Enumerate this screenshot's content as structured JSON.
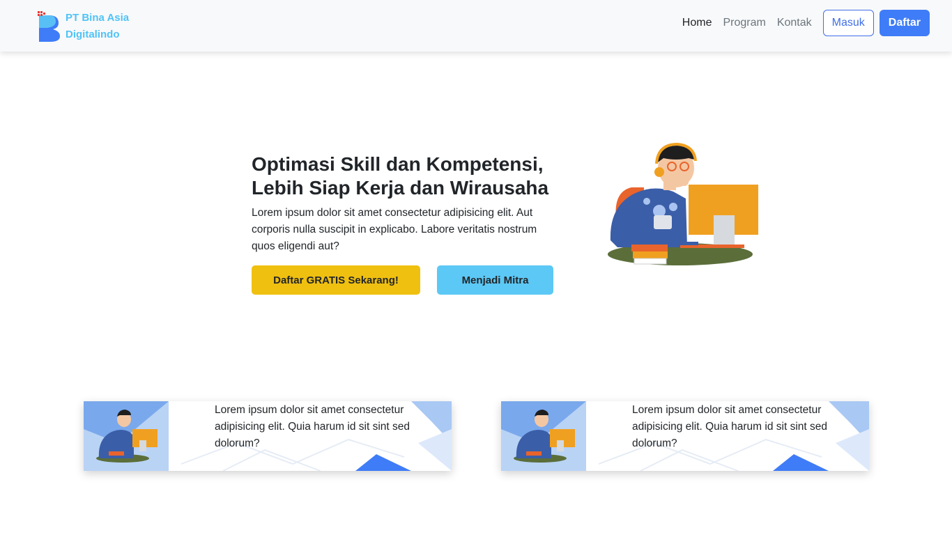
{
  "brand": {
    "line1": "PT Bina Asia",
    "line2": "Digitalindo"
  },
  "nav": {
    "links": [
      "Home",
      "Program",
      "Kontak"
    ],
    "active": "Home",
    "login_label": "Masuk",
    "register_label": "Daftar"
  },
  "hero": {
    "title_line1": "Optimasi Skill dan Kompetensi,",
    "title_line2": "Lebih Siap Kerja dan Wirausaha",
    "description": "Lorem ipsum dolor sit amet consectetur adipisicing elit. Aut corporis nulla suscipit in explicabo. Labore veritatis nostrum quos eligendi aut?",
    "cta_primary": "Daftar GRATIS Sekarang!",
    "cta_secondary": "Menjadi Mitra"
  },
  "cards": [
    {
      "text": "Lorem ipsum dolor sit amet consectetur adipisicing elit. Quia harum id sit sint sed dolorum?"
    },
    {
      "text": "Lorem ipsum dolor sit amet consectetur adipisicing elit. Quia harum id sit sint sed dolorum?"
    }
  ],
  "colors": {
    "brand_text": "#4fc3f7",
    "primary": "#3f7cf7",
    "yellow": "#f0c010",
    "cyan": "#5cc8f5"
  }
}
